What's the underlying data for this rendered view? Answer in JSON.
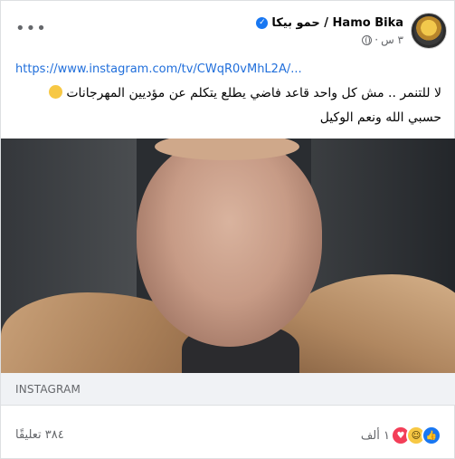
{
  "post": {
    "author_name": "حمو بيكا / Hamo Bika",
    "time": "٣ س",
    "separator": "·",
    "link": "https://www.instagram.com/tv/CWqR0vMhL2A/...",
    "text_line1": "لا للتنمر .. مش كل واحد قاعد فاضي يطلع يتكلم عن مؤديين المهرجانات",
    "text_line2": "حسبي الله ونعم الوكيل",
    "more_label": "•••"
  },
  "attachment": {
    "source": "INSTAGRAM"
  },
  "footer": {
    "comments": "٣٨٤ تعليقًا",
    "reactions_count": "١ ألف",
    "reactions": [
      "like-icon",
      "haha-icon",
      "love-icon"
    ]
  },
  "colors": {
    "link": "#216fdb",
    "verified": "#1877f2",
    "like": "#1877f2",
    "love": "#f33e58",
    "haha": "#f7c844"
  }
}
